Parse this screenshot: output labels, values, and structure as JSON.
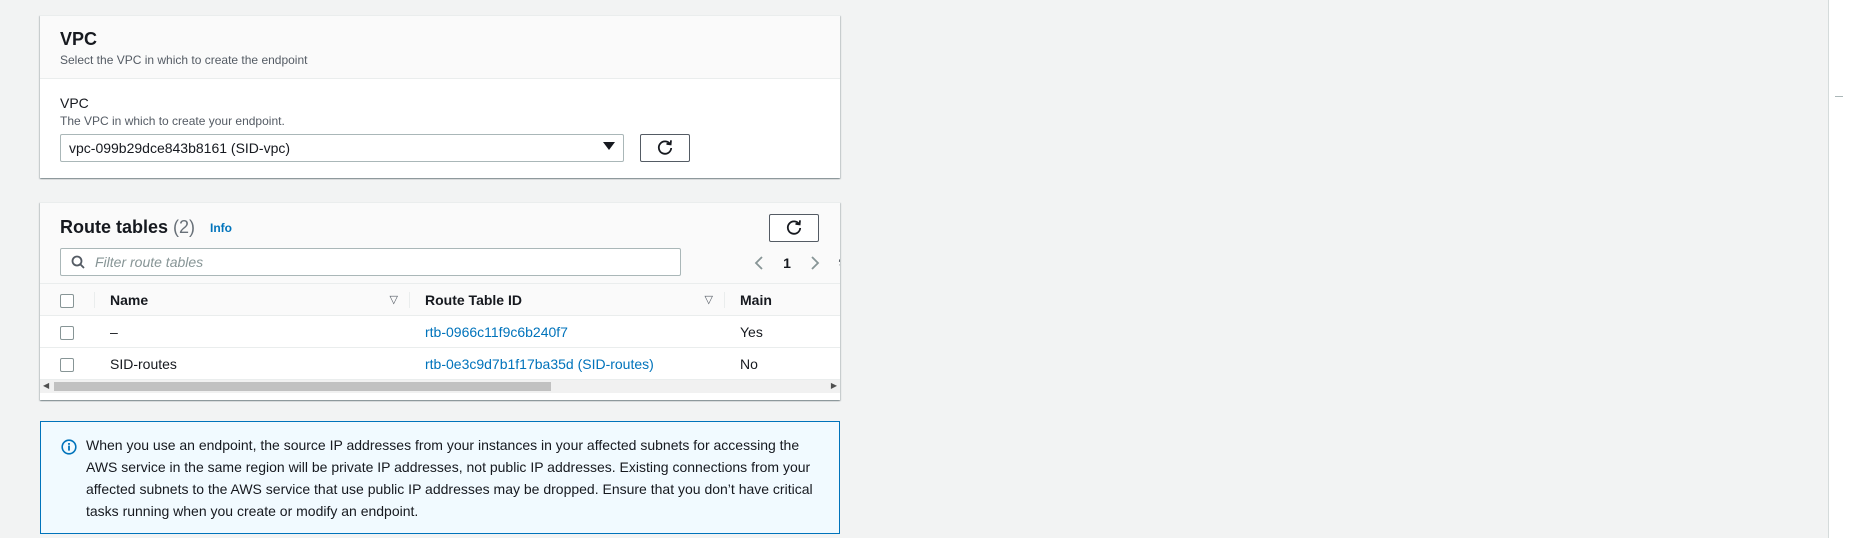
{
  "vpc_section": {
    "title": "VPC",
    "description": "Select the VPC in which to create the endpoint",
    "field_label": "VPC",
    "field_description": "The VPC in which to create your endpoint.",
    "selected_value": "vpc-099b29dce843b8161 (SID-vpc)"
  },
  "route_tables": {
    "title": "Route tables",
    "count": "(2)",
    "info_label": "Info",
    "filter_placeholder": "Filter route tables",
    "current_page": "1",
    "columns": {
      "name": "Name",
      "route_table_id": "Route Table ID",
      "main": "Main"
    },
    "rows": [
      {
        "name": "–",
        "route_table_id": "rtb-0966c11f9c6b240f7",
        "main": "Yes"
      },
      {
        "name": "SID-routes",
        "route_table_id": "rtb-0e3c9d7b1f17ba35d (SID-routes)",
        "main": "No"
      }
    ],
    "horizontal_scroll_fraction": 0.55
  },
  "alert": {
    "text": "When you use an endpoint, the source IP addresses from your instances in your affected subnets for accessing the AWS service in the same region will be private IP addresses, not public IP addresses. Existing connections from your affected subnets to the AWS service that use public IP addresses may be dropped. Ensure that you don’t have critical tasks running when you create or modify an endpoint.",
    "icon": "info-icon"
  },
  "colors": {
    "link": "#0073bb",
    "alert_border": "#0073bb",
    "alert_background": "#f1faff",
    "page_background": "#f2f3f3"
  }
}
